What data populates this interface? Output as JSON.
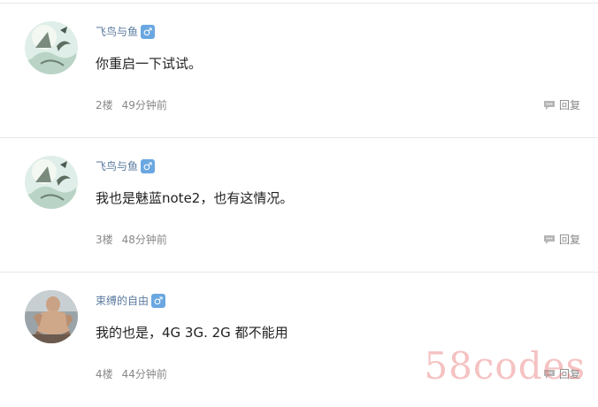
{
  "comments": [
    {
      "username": "飞鸟与鱼",
      "gender": "♂",
      "text": "你重启一下试试。",
      "floor": "2楼",
      "time": "49分钟前",
      "reply_label": "回复"
    },
    {
      "username": "飞鸟与鱼",
      "gender": "♂",
      "text": "我也是魅蓝note2，也有这情况。",
      "floor": "3楼",
      "time": "48分钟前",
      "reply_label": "回复"
    },
    {
      "username": "束缚的自由",
      "gender": "♂",
      "text": "我的也是，4G 3G. 2G 都不能用",
      "floor": "4楼",
      "time": "44分钟前",
      "reply_label": "回复"
    }
  ],
  "watermark": "58codes",
  "colors": {
    "username": "#5a7a9e",
    "gender_badge": "#6aa7e0",
    "meta_text": "#888888",
    "divider": "#e8e8e8"
  },
  "icons": {
    "gender": "male-icon",
    "reply": "speech-bubble-icon"
  }
}
